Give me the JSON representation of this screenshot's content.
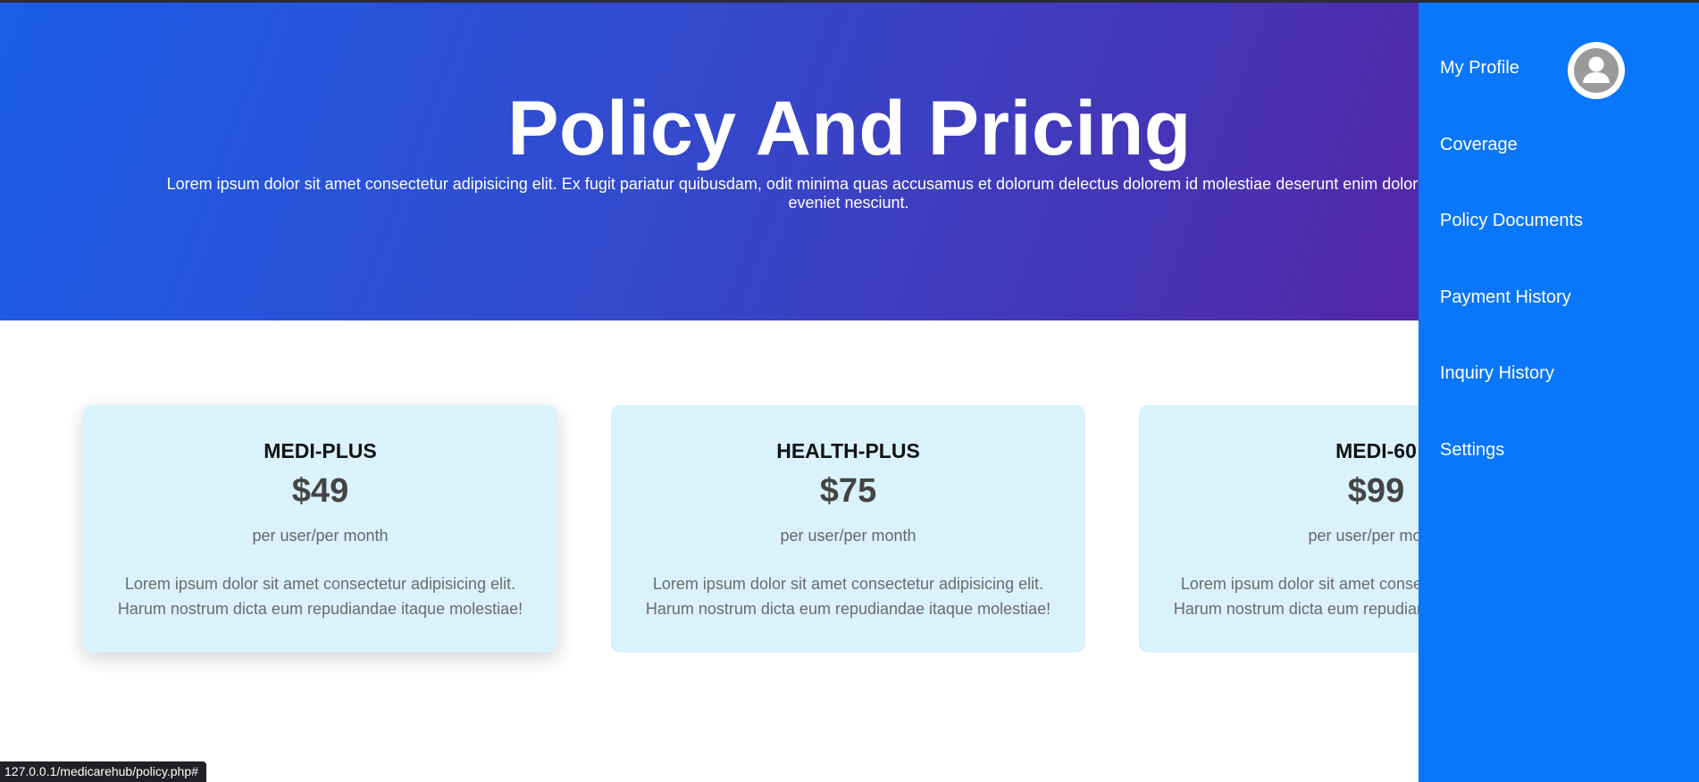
{
  "hero": {
    "title": "Policy And Pricing",
    "subtitle": "Lorem ipsum dolor sit amet consectetur adipisicing elit. Ex fugit pariatur quibusdam, odit minima quas accusamus et dolorum delectus dolorem id molestiae deserunt enim dolor, natus sapiente eveniet nesciunt."
  },
  "plans": [
    {
      "name": "MEDI-PLUS",
      "price": "$49",
      "period": "per user/per month",
      "description": "Lorem ipsum dolor sit amet consectetur adipisicing elit. Harum nostrum dicta eum repudiandae itaque molestiae!"
    },
    {
      "name": "HEALTH-PLUS",
      "price": "$75",
      "period": "per user/per month",
      "description": "Lorem ipsum dolor sit amet consectetur adipisicing elit. Harum nostrum dicta eum repudiandae itaque molestiae!"
    },
    {
      "name": "MEDI-60",
      "price": "$99",
      "period": "per user/per month",
      "description": "Lorem ipsum dolor sit amet consectetur adipisicing elit. Harum nostrum dicta eum repudiandae itaque molestiae!"
    }
  ],
  "sidebar": {
    "items": [
      {
        "label": "My Profile"
      },
      {
        "label": "Coverage"
      },
      {
        "label": "Policy Documents"
      },
      {
        "label": "Payment History"
      },
      {
        "label": "Inquiry History"
      },
      {
        "label": "Settings"
      }
    ],
    "avatar_icon": "user-avatar-icon"
  },
  "statusbar": {
    "url": "127.0.0.1/medicarehub/policy.php#"
  },
  "colors": {
    "sidebar": "#0a77fb",
    "card_bg": "#d9f2fc",
    "hero_start": "#1b5ee8",
    "hero_end": "#6a1399"
  }
}
